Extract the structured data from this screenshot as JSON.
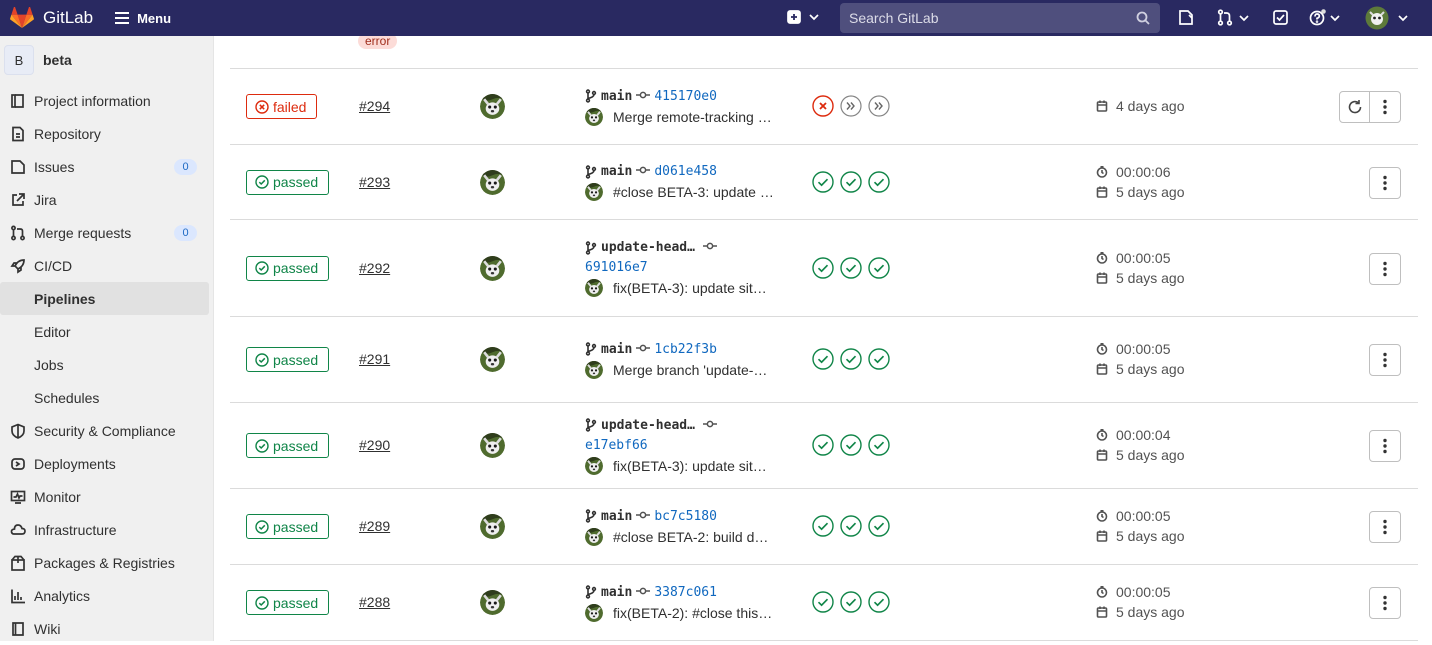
{
  "topbar": {
    "brand": "GitLab",
    "menu_label": "Menu",
    "search_placeholder": "Search GitLab"
  },
  "sidebar": {
    "project_initial": "B",
    "project_name": "beta",
    "items": [
      {
        "label": "Project information",
        "icon": "info-icon"
      },
      {
        "label": "Repository",
        "icon": "doc-icon"
      },
      {
        "label": "Issues",
        "icon": "issues-icon",
        "count": "0"
      },
      {
        "label": "Jira",
        "icon": "external-link-icon"
      },
      {
        "label": "Merge requests",
        "icon": "merge-request-icon",
        "count": "0"
      },
      {
        "label": "CI/CD",
        "icon": "rocket-icon"
      },
      {
        "label": "Pipelines",
        "active": true
      },
      {
        "label": "Editor"
      },
      {
        "label": "Jobs"
      },
      {
        "label": "Schedules"
      },
      {
        "label": "Security & Compliance",
        "icon": "shield-icon"
      },
      {
        "label": "Deployments",
        "icon": "deployments-icon"
      },
      {
        "label": "Monitor",
        "icon": "monitor-icon"
      },
      {
        "label": "Infrastructure",
        "icon": "cloud-icon"
      },
      {
        "label": "Packages & Registries",
        "icon": "package-icon"
      },
      {
        "label": "Analytics",
        "icon": "chart-icon"
      },
      {
        "label": "Wiki",
        "icon": "book-icon"
      }
    ]
  },
  "partial_row": {
    "badge": "error"
  },
  "pipelines": [
    {
      "status": "failed",
      "id": "#294",
      "ref": "main",
      "sha": "415170e0",
      "message": "Merge remote-tracking …",
      "stages": [
        "failed",
        "skipped",
        "skipped"
      ],
      "duration": "",
      "finished": "4 days ago",
      "retry": true
    },
    {
      "status": "passed",
      "id": "#293",
      "ref": "main",
      "sha": "d061e458",
      "message": "#close BETA-3: update …",
      "stages": [
        "success",
        "success",
        "success"
      ],
      "duration": "00:00:06",
      "finished": "5 days ago"
    },
    {
      "status": "passed",
      "id": "#292",
      "ref": "update-head…",
      "sha": "691016e7",
      "message": "fix(BETA-3): update sit…",
      "stages": [
        "success",
        "success",
        "success"
      ],
      "duration": "00:00:05",
      "finished": "5 days ago",
      "wrap": true
    },
    {
      "status": "passed",
      "id": "#291",
      "ref": "main",
      "sha": "1cb22f3b",
      "message": "Merge branch 'update-…",
      "stages": [
        "success",
        "success",
        "success"
      ],
      "duration": "00:00:05",
      "finished": "5 days ago"
    },
    {
      "status": "passed",
      "id": "#290",
      "ref": "update-head…",
      "sha": "e17ebf66",
      "message": "fix(BETA-3): update sit…",
      "stages": [
        "success",
        "success",
        "success"
      ],
      "duration": "00:00:04",
      "finished": "5 days ago",
      "wrap": true
    },
    {
      "status": "passed",
      "id": "#289",
      "ref": "main",
      "sha": "bc7c5180",
      "message": "#close BETA-2: build d…",
      "stages": [
        "success",
        "success",
        "success"
      ],
      "duration": "00:00:05",
      "finished": "5 days ago"
    },
    {
      "status": "passed",
      "id": "#288",
      "ref": "main",
      "sha": "3387c061",
      "message": "fix(BETA-2): #close this…",
      "stages": [
        "success",
        "success",
        "success"
      ],
      "duration": "00:00:05",
      "finished": "5 days ago"
    }
  ],
  "colors": {
    "topbar": "#292961",
    "success": "#108548",
    "failed": "#dd2b0e",
    "link": "#1068bf"
  }
}
